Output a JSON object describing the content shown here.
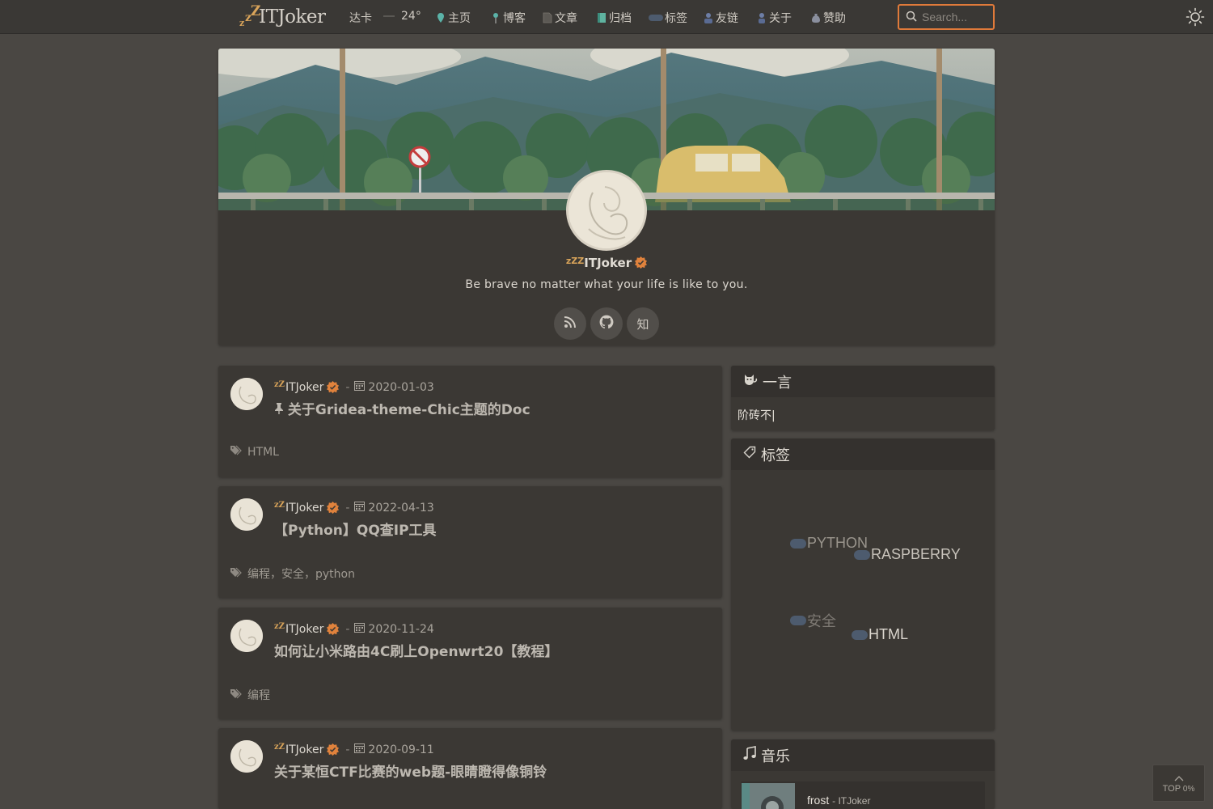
{
  "nav": {
    "logo_text": "ITJoker",
    "checkin": "达卡",
    "temperature": "24°",
    "items": [
      {
        "label": "主页",
        "icon": "pin-icon"
      },
      {
        "label": "博客",
        "icon": "pushpin-icon"
      },
      {
        "label": "文章",
        "icon": "document-icon"
      },
      {
        "label": "归档",
        "icon": "book-icon"
      },
      {
        "label": "标签",
        "icon": "tag-icon"
      },
      {
        "label": "友链",
        "icon": "friends-icon"
      },
      {
        "label": "关于",
        "icon": "person-icon"
      },
      {
        "label": "赞助",
        "icon": "money-bag-icon"
      }
    ],
    "search_placeholder": "Search..."
  },
  "profile": {
    "name": "ITJoker",
    "motto": "Be brave no matter what your life is like to you.",
    "social_zhihu": "知"
  },
  "posts": [
    {
      "author": "ITJoker",
      "date": "2020-01-03",
      "pinned": true,
      "title": "关于Gridea-theme-Chic主题的Doc",
      "tags": "HTML"
    },
    {
      "author": "ITJoker",
      "date": "2022-04-13",
      "pinned": false,
      "title": "【Python】QQ查IP工具",
      "tags": "编程，安全，python"
    },
    {
      "author": "ITJoker",
      "date": "2020-11-24",
      "pinned": false,
      "title": "如何让小米路由4C刷上Openwrt20【教程】",
      "tags": "编程"
    },
    {
      "author": "ITJoker",
      "date": "2020-09-11",
      "pinned": false,
      "title": "关于某恒CTF比赛的web题-眼睛瞪得像铜铃",
      "tags": ""
    }
  ],
  "widgets": {
    "hitokoto_title": "一言",
    "hitokoto_text": "阶砖不|",
    "tags_title": "标签",
    "tag_cloud": [
      {
        "label": "PYTHON",
        "color": "#9a958d"
      },
      {
        "label": "RASPBERRY",
        "color": "#c9c4bc"
      },
      {
        "label": "安全",
        "color": "#7d7973"
      },
      {
        "label": "HTML",
        "color": "#dcd7cf"
      }
    ],
    "music_title": "音乐",
    "music_track": "frost",
    "music_artist": "ITJoker"
  },
  "top_button": {
    "label": "TOP",
    "percent": "0%"
  },
  "colors": {
    "accent": "#e07a3a",
    "verified": "#e0823c",
    "background": "#4a4743",
    "card": "#3b3834"
  }
}
